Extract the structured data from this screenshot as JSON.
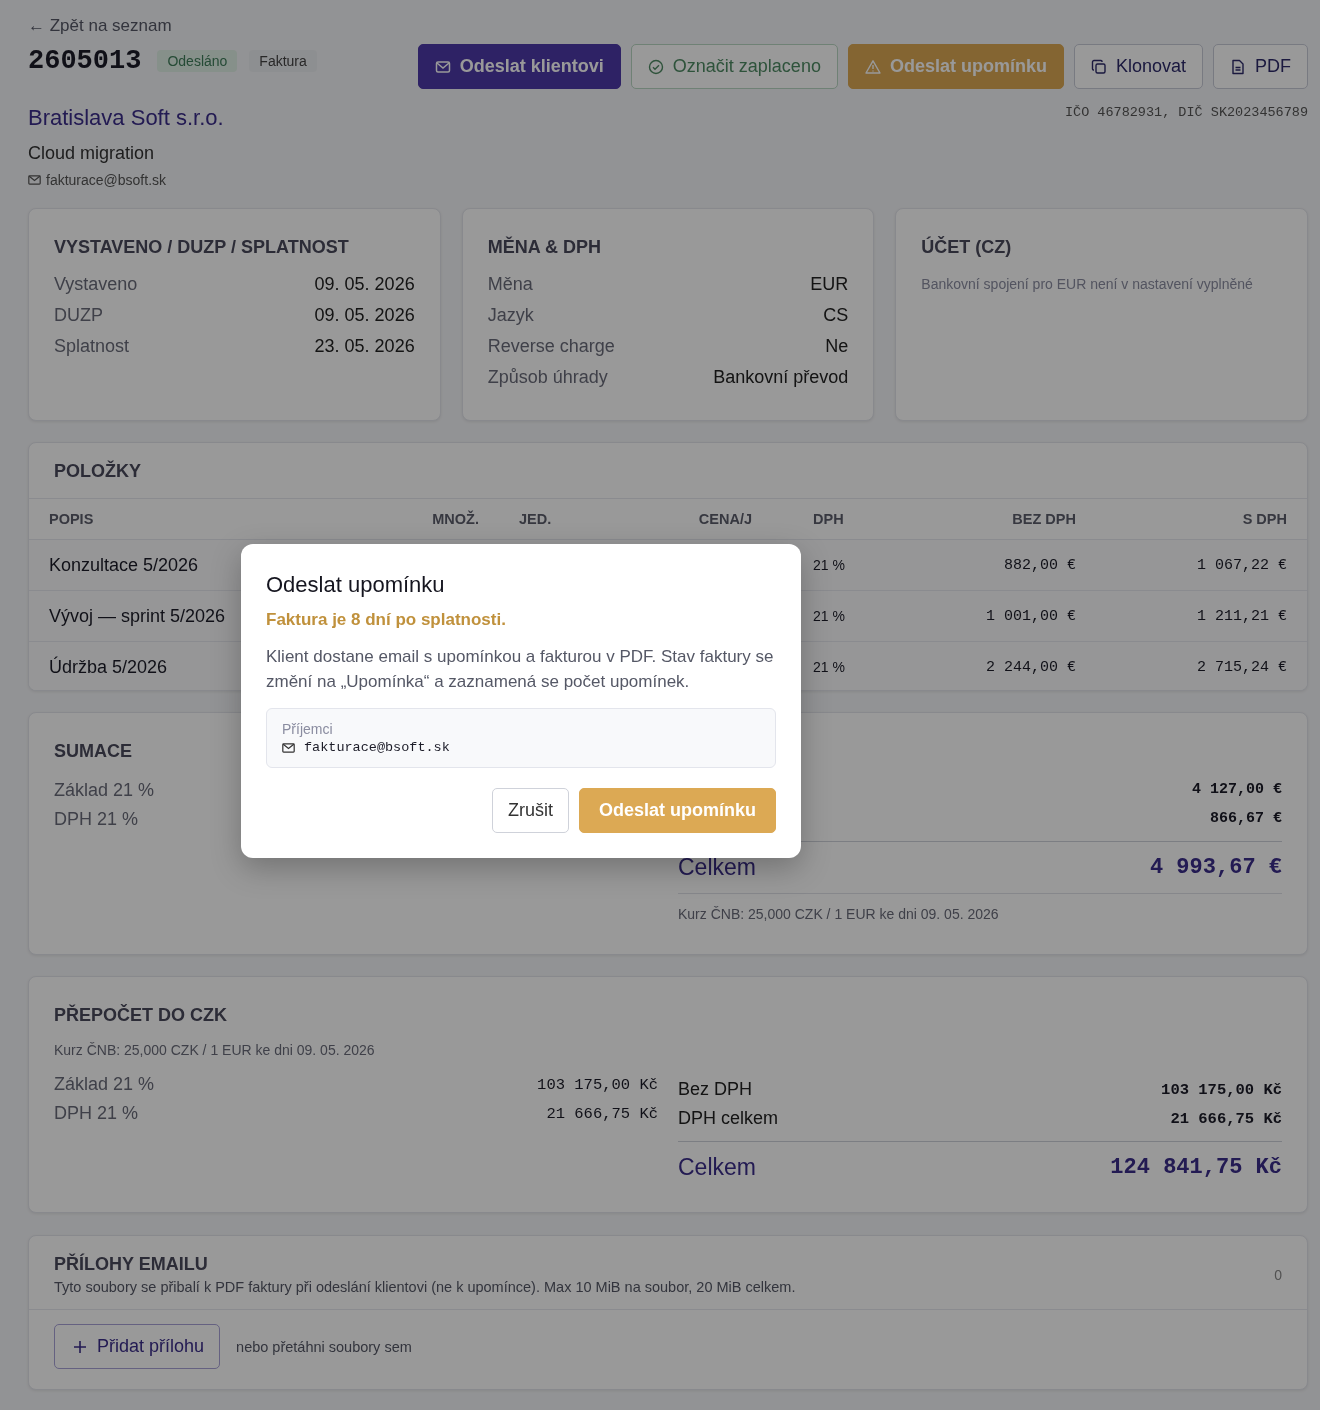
{
  "back_link": "← Zpět na seznam",
  "invoice": {
    "number": "2605013",
    "badges": [
      {
        "label": "Odesláno",
        "kind": "status"
      },
      {
        "label": "Faktura",
        "kind": "type"
      }
    ]
  },
  "actions": [
    {
      "label": "Odeslat klientovi",
      "kind": "send"
    },
    {
      "label": "Označit zaplaceno",
      "kind": "paid"
    },
    {
      "label": "Odeslat upomínku",
      "kind": "remind"
    },
    {
      "label": "Klonovat",
      "kind": "clone"
    },
    {
      "label": "PDF",
      "kind": "pdf"
    }
  ],
  "client": {
    "name": "Bratislava Soft s.r.o.",
    "project": "Cloud migration",
    "email": "fakturace@bsoft.sk",
    "ids": "IČO 46782931, DIČ SK2023456789"
  },
  "info_cards": [
    {
      "title": "VYSTAVENO / DUZP / SPLATNOST",
      "rows": [
        {
          "label": "Vystaveno",
          "value": "09. 05. 2026"
        },
        {
          "label": "DUZP",
          "value": "09. 05. 2026"
        },
        {
          "label": "Splatnost",
          "value": "23. 05. 2026"
        }
      ]
    },
    {
      "title": "MĚNA & DPH",
      "rows": [
        {
          "label": "Měna",
          "value": "EUR"
        },
        {
          "label": "Jazyk",
          "value": "CS"
        },
        {
          "label": "Reverse charge",
          "value": "Ne"
        },
        {
          "label": "Způsob úhrady",
          "value": "Bankovní převod"
        }
      ]
    },
    {
      "title": "ÚČET (CZ)",
      "note": "Bankovní spojení pro EUR není v nastavení vyplněné"
    }
  ],
  "items": {
    "title": "POLOŽKY",
    "columns": [
      "POPIS",
      "MNOŽ.",
      "JED.",
      "CENA/J",
      "DPH",
      "BEZ DPH",
      "S DPH"
    ],
    "rows": [
      {
        "description": "Konzultace 5/2026",
        "vat": "21 %",
        "net": "882,00 €",
        "gross": "1 067,22 €"
      },
      {
        "description": "Vývoj — sprint 5/2026",
        "vat": "21 %",
        "net": "1 001,00 €",
        "gross": "1 211,21 €"
      },
      {
        "description": "Údržba 5/2026",
        "vat": "21 %",
        "net": "2 244,00 €",
        "gross": "2 715,24 €"
      }
    ]
  },
  "summary": {
    "title": "SUMACE",
    "left_labels": [
      "Základ 21 %",
      "DPH 21 %"
    ],
    "right_values": [
      "4 127,00 €",
      "866,67 €"
    ],
    "total_label": "Celkem",
    "total_value": "4 993,67 €",
    "rate_note": "Kurz ČNB: 25,000 CZK / 1 EUR ke dni 09. 05. 2026"
  },
  "czk": {
    "title": "PŘEPOČET DO CZK",
    "rate_note": "Kurz ČNB: 25,000 CZK / 1 EUR ke dni 09. 05. 2026",
    "left_rows": [
      {
        "label": "Základ 21 %",
        "value": "103 175,00 Kč"
      },
      {
        "label": "DPH 21 %",
        "value": "21 666,75 Kč"
      }
    ],
    "right_rows": [
      {
        "label": "Bez DPH",
        "value": "103 175,00 Kč"
      },
      {
        "label": "DPH celkem",
        "value": "21 666,75 Kč"
      }
    ],
    "total_label": "Celkem",
    "total_value": "124 841,75 Kč"
  },
  "attachments": {
    "title": "PŘÍLOHY EMAILU",
    "description": "Tyto soubory se přibalí k PDF faktury při odeslání klientovi (ne k upomínce). Max 10 MiB na soubor, 20 MiB celkem.",
    "count": "0",
    "add_button": "Přidat přílohu",
    "drop_hint": "nebo přetáhni soubory sem"
  },
  "dialog": {
    "title": "Odeslat upomínku",
    "warning": "Faktura je 8 dní po splatnosti.",
    "body": "Klient dostane email s upomínkou a fakturou v PDF. Stav faktury se změní na „Upomínka“ a zaznamená se počet upomínek.",
    "recipients_label": "Příjemci",
    "recipient": "fakturace@bsoft.sk",
    "buttons": [
      {
        "label": "Zrušit",
        "kind": "secondary"
      },
      {
        "label": "Odeslat upomínku",
        "kind": "confirm"
      }
    ]
  }
}
